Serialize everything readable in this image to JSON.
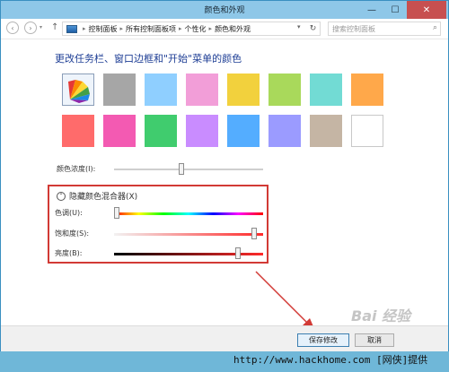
{
  "window": {
    "title": "颜色和外观"
  },
  "sys_buttons": {
    "minimize": "—",
    "maximize": "☐",
    "close": "✕"
  },
  "nav": {
    "back": "‹",
    "forward": "›",
    "up": "↑",
    "dropdown": "▾",
    "refresh": "↻",
    "breadcrumb": [
      "控制面板",
      "所有控制面板项",
      "个性化",
      "颜色和外观"
    ],
    "search_placeholder": "搜索控制面板",
    "search_icon": "magnifier-icon"
  },
  "heading": "更改任务栏、窗口边框和\"开始\"菜单的颜色",
  "swatches": [
    {
      "color": "#4a8fd8",
      "kind": "auto-icon",
      "selected": true
    },
    {
      "color": "#a6a6a6"
    },
    {
      "color": "#8fcfff"
    },
    {
      "color": "#f29ed8"
    },
    {
      "color": "#f2d13d"
    },
    {
      "color": "#a9d95b"
    },
    {
      "color": "#72dbd4"
    },
    {
      "color": "#ffa84a"
    },
    {
      "color": "#ff6b6b"
    },
    {
      "color": "#f35ab2"
    },
    {
      "color": "#40cc6e"
    },
    {
      "color": "#c98cff"
    },
    {
      "color": "#54adff"
    },
    {
      "color": "#9b9bff"
    },
    {
      "color": "#c5b5a4"
    },
    {
      "color": "#ffffff"
    }
  ],
  "intensity": {
    "label": "颜色浓度(I):",
    "value": 0.45
  },
  "mixer": {
    "toggle_glyph": "⌃",
    "title": "隐藏颜色混合器(X)",
    "hue": {
      "label": "色调(U):",
      "value": 0.02
    },
    "saturation": {
      "label": "饱和度(S):",
      "value": 0.94
    },
    "brightness": {
      "label": "亮度(B):",
      "value": 0.83
    },
    "accent": "#d23a35"
  },
  "footer": {
    "save": "保存修改",
    "cancel": "取消"
  },
  "watermark": "Bai 经验",
  "website": "http://www.hackhome.com [网侠]提供"
}
